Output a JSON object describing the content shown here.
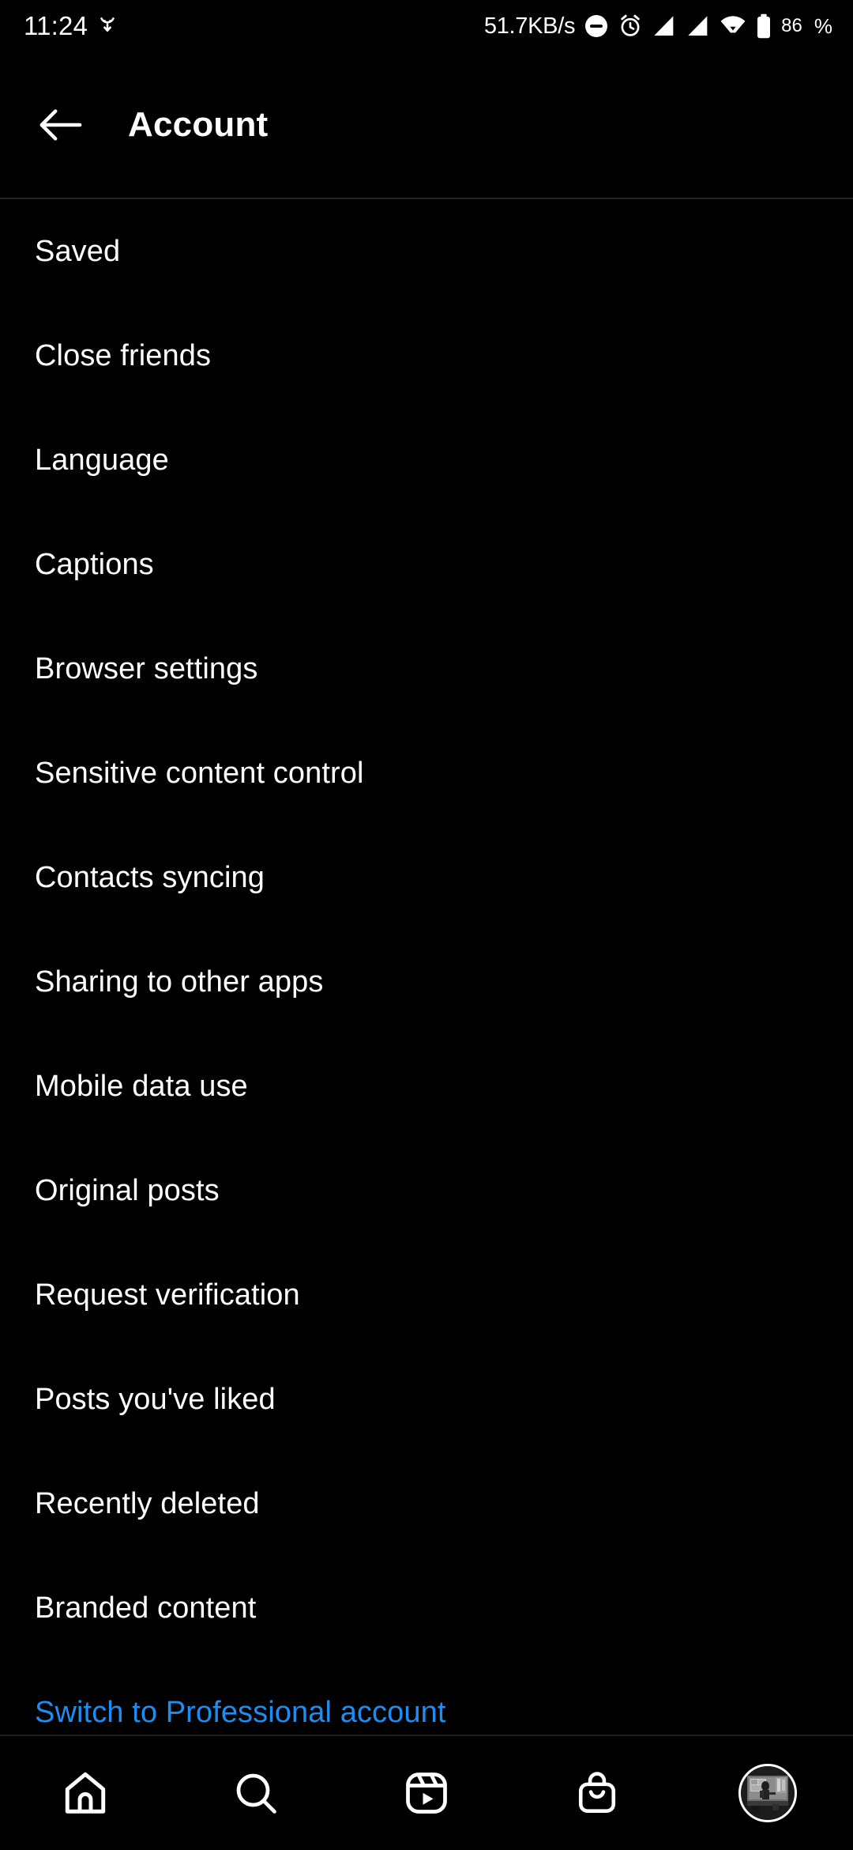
{
  "status_bar": {
    "time": "11:24",
    "left_icon": "download-indicator-icon",
    "network_speed": "51.7KB/s",
    "icons": [
      "do-not-disturb-icon",
      "alarm-icon",
      "signal-sim1-icon",
      "signal-sim2-icon",
      "wifi-icon",
      "battery-icon"
    ],
    "battery_level": "86",
    "battery_percent_symbol": "%"
  },
  "app_bar": {
    "back_icon": "back-arrow-icon",
    "title": "Account"
  },
  "settings_list": {
    "items": [
      {
        "label": "Saved",
        "type": "normal"
      },
      {
        "label": "Close friends",
        "type": "normal"
      },
      {
        "label": "Language",
        "type": "normal"
      },
      {
        "label": "Captions",
        "type": "normal"
      },
      {
        "label": "Browser settings",
        "type": "normal"
      },
      {
        "label": "Sensitive content control",
        "type": "normal"
      },
      {
        "label": "Contacts syncing",
        "type": "normal"
      },
      {
        "label": "Sharing to other apps",
        "type": "normal"
      },
      {
        "label": "Mobile data use",
        "type": "normal"
      },
      {
        "label": "Original posts",
        "type": "normal"
      },
      {
        "label": "Request verification",
        "type": "normal"
      },
      {
        "label": "Posts you've liked",
        "type": "normal"
      },
      {
        "label": "Recently deleted",
        "type": "normal"
      },
      {
        "label": "Branded content",
        "type": "normal"
      },
      {
        "label": "Switch to Professional account",
        "type": "link"
      }
    ]
  },
  "bottom_nav": {
    "items": [
      {
        "name": "nav-home",
        "icon": "home-icon"
      },
      {
        "name": "nav-search",
        "icon": "search-icon"
      },
      {
        "name": "nav-reels",
        "icon": "reels-icon"
      },
      {
        "name": "nav-shop",
        "icon": "shop-bag-icon"
      },
      {
        "name": "nav-profile",
        "icon": "profile-avatar-icon"
      }
    ]
  },
  "colors": {
    "background": "#000000",
    "text": "#ffffff",
    "link": "#1f8cf0",
    "divider": "#262626"
  }
}
